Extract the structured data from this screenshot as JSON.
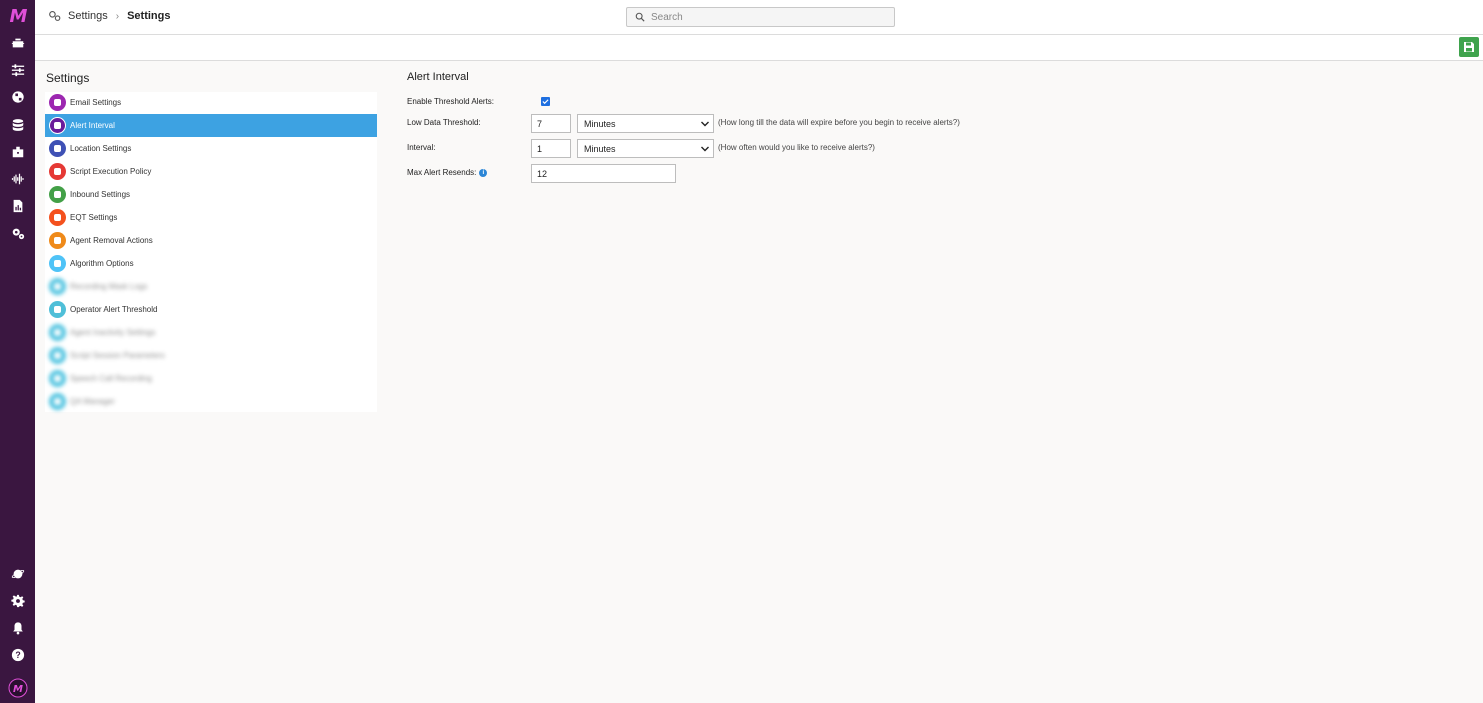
{
  "rail": {
    "logo": "M",
    "top_icons": [
      "dashboard-icon",
      "sliders-icon",
      "globe-icon",
      "database-icon",
      "briefcase-icon",
      "waveform-icon",
      "report-icon",
      "cogs-icon"
    ],
    "bottom_icons": [
      "planet-icon",
      "gear-icon",
      "bell-icon",
      "help-icon",
      "user-avatar-icon"
    ]
  },
  "header": {
    "breadcrumb": {
      "root": "Settings",
      "separator": "›",
      "current": "Settings"
    },
    "search": {
      "placeholder": "Search",
      "value": ""
    }
  },
  "toolbar": {
    "save_icon": "save-icon",
    "save_color": "#3fa34d"
  },
  "sidebar": {
    "title": "Settings",
    "active_color": "#3da2e2",
    "items": [
      {
        "label": "Email Settings",
        "color": "#9c27b0",
        "icon": "at-icon"
      },
      {
        "label": "Alert Interval",
        "color": "#6a1b9a",
        "icon": "alarm-icon",
        "active": true
      },
      {
        "label": "Location Settings",
        "color": "#3f51b5",
        "icon": "pin-icon"
      },
      {
        "label": "Script Execution Policy",
        "color": "#e53935",
        "icon": "clipboard-icon"
      },
      {
        "label": "Inbound Settings",
        "color": "#43a047",
        "icon": "phone-icon"
      },
      {
        "label": "EQT Settings",
        "color": "#f4511e",
        "icon": "clock-icon"
      },
      {
        "label": "Agent Removal Actions",
        "color": "#ef8a1a",
        "icon": "user-remove-icon"
      },
      {
        "label": "Algorithm Options",
        "color": "#4fc3f7",
        "icon": "grid-icon"
      },
      {
        "label": "Recording Mask Logs",
        "color": "#4fc3e0",
        "icon": "gear-icon",
        "blurred": true
      },
      {
        "label": "Operator Alert Threshold",
        "color": "#4fbfd8",
        "icon": "gear-icon"
      },
      {
        "label": "Agent Inactivity Settings",
        "color": "#4fc3e0",
        "icon": "gear-icon",
        "blurred": true
      },
      {
        "label": "Script Session Parameters",
        "color": "#4fc3e0",
        "icon": "gear-icon",
        "blurred": true
      },
      {
        "label": "Speech Call Recording",
        "color": "#4fc3e0",
        "icon": "gear-icon",
        "blurred": true
      },
      {
        "label": "QA Manager",
        "color": "#4fc3e0",
        "icon": "gear-icon",
        "blurred": true
      }
    ]
  },
  "form": {
    "title": "Alert Interval",
    "enable_label": "Enable Threshold Alerts:",
    "enable_checked": true,
    "low_label": "Low Data Threshold:",
    "low_value": "7",
    "low_unit": "Minutes",
    "low_hint": "(How long till the data will expire before you begin to receive alerts?)",
    "interval_label": "Interval:",
    "interval_value": "1",
    "interval_unit": "Minutes",
    "interval_hint": "(How often would you like to receive alerts?)",
    "resends_label": "Max Alert Resends:",
    "resends_value": "12"
  }
}
